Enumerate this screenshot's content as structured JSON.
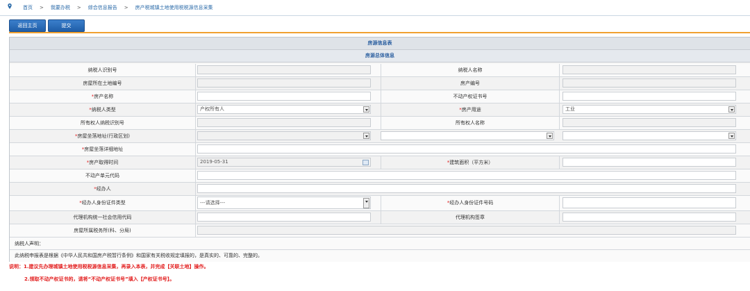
{
  "breadcrumb": [
    "首页",
    "我要办税",
    "综合信息报告",
    "房产税城镇土地使用税税源信息采集"
  ],
  "breadcrumb_sep": ">",
  "toolbar": {
    "back_label": "返回主页",
    "submit_label": "提交"
  },
  "sections": {
    "title": "房源信息表",
    "subtitle": "房源总体信息"
  },
  "required_mark": "*",
  "fields": {
    "taxpayer_id": {
      "label": "纳税人识别号",
      "value": ""
    },
    "taxpayer_name": {
      "label": "纳税人名称",
      "value": ""
    },
    "land_no": {
      "label": "房屋所在土地编号",
      "value": ""
    },
    "property_no": {
      "label": "房产编号",
      "value": ""
    },
    "property_name": {
      "label": "房产名称",
      "value": ""
    },
    "cert_no": {
      "label": "不动产权证书号",
      "value": ""
    },
    "taxpayer_type": {
      "label": "纳税人类型",
      "value": "产权所有人"
    },
    "property_use": {
      "label": "房产用途",
      "value": "工业"
    },
    "owner_id": {
      "label": "所有权人纳税识别号",
      "value": ""
    },
    "owner_name": {
      "label": "所有权人名称",
      "value": ""
    },
    "location": {
      "label": "房屋坐落地址(行政区划)"
    },
    "detail_address": {
      "label": "房屋坐落详细地址",
      "value": ""
    },
    "acquire_date": {
      "label": "房产取得时间",
      "value": "2019-05-31"
    },
    "building_area": {
      "label": "建筑面积（平方米）",
      "value": ""
    },
    "unit_code": {
      "label": "不动产单元代码",
      "value": ""
    },
    "handler": {
      "label": "经办人",
      "value": ""
    },
    "handler_id_type": {
      "label": "经办人身份证件类型",
      "value": "---请选择---"
    },
    "handler_id_no": {
      "label": "经办人身份证件号码",
      "value": ""
    },
    "agency_code": {
      "label": "代理机构统一社会信用代码",
      "value": ""
    },
    "agency_seal": {
      "label": "代理机构签章",
      "value": ""
    },
    "tax_office": {
      "label": "房屋所属税务所(科、分局)",
      "value": ""
    }
  },
  "declaration": {
    "title": "纳税人声明：",
    "text": "此纳税申报表是根据《中华人民共和国房产税暂行条例》和国家有关税收规定填报的，是真实的、可靠的、完整的。"
  },
  "tips": [
    "说明：1.建议先办理城镇土地使用税税源信息采集，再录入本表，并完成【关联土地】操作。",
    "2.领取不动产权证书的，请将“不动产权证书号”填入【产权证书号】。"
  ],
  "colors": {
    "link": "#2a6aa8",
    "header_text": "#2b5fa0",
    "required": "#e02020",
    "accent_rule": "#f0a030",
    "button": "#2a6cb8"
  }
}
